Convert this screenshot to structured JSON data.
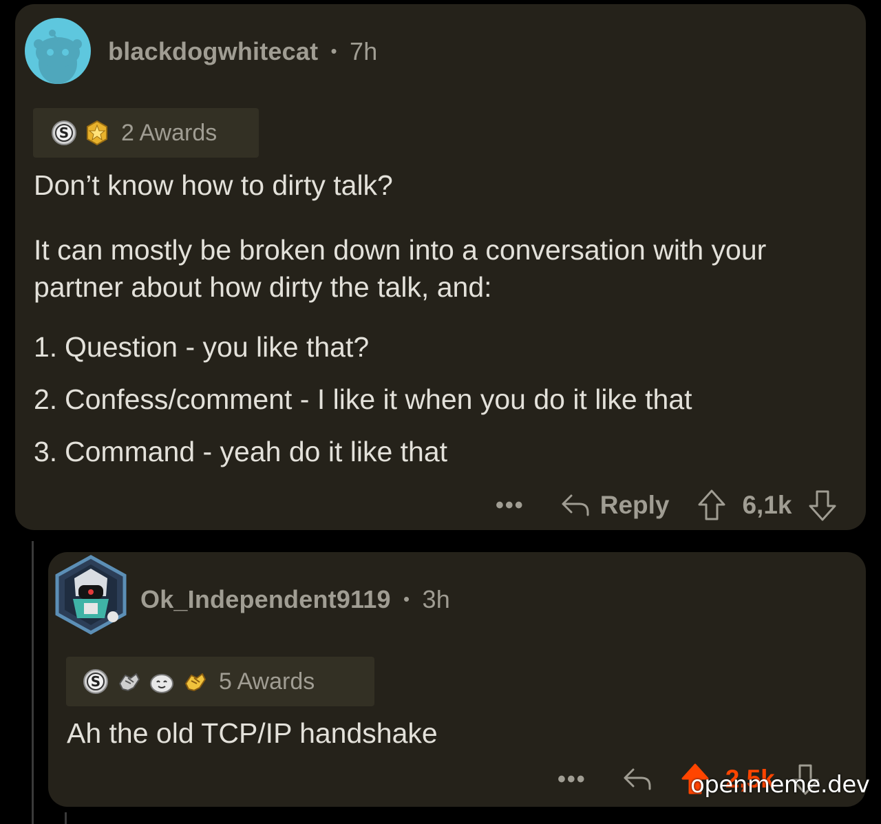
{
  "comments": [
    {
      "username": "blackdogwhitecat",
      "separator": "•",
      "time": "7h",
      "awards_label": "2 Awards",
      "paragraphs": [
        "Don’t know how to dirty talk?",
        "It can mostly be broken down into a conversation with your partner about how dirty the talk, and:"
      ],
      "list": [
        {
          "num": "1.",
          "text": "Question - you like that?"
        },
        {
          "num": "2.",
          "text": "Confess/comment - I like it when you do it like that"
        },
        {
          "num": "3.",
          "text": "Command - yeah do it like that"
        }
      ],
      "more_label": "•••",
      "reply_label": "Reply",
      "score": "6,1k"
    },
    {
      "username": "Ok_Independent9119",
      "separator": "•",
      "time": "3h",
      "awards_label": "5 Awards",
      "text": "Ah the old TCP/IP handshake",
      "more_label": "•••",
      "score": "2,5k"
    }
  ],
  "watermark": "openmeme.dev",
  "colors": {
    "background": "#000000",
    "card": "#25221a",
    "muted_text": "#a09d93",
    "body_text": "#e3e1da",
    "upvoted": "#ff4500"
  }
}
